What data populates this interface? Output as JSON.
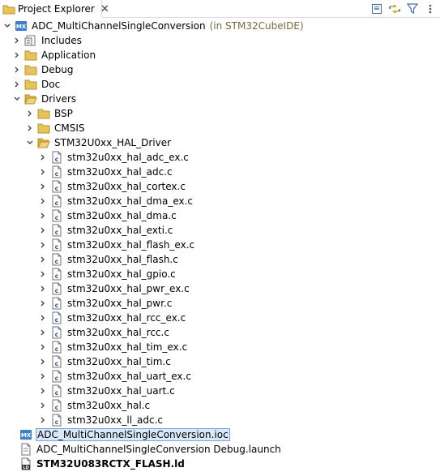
{
  "view": {
    "title": "Project Explorer",
    "close_glyph": "✕",
    "toolbar": [
      {
        "name": "collapse-all-icon"
      },
      {
        "name": "link-with-editor-icon"
      },
      {
        "name": "filter-icon"
      },
      {
        "name": "view-menu-icon"
      }
    ]
  },
  "tree": {
    "project": {
      "label": "ADC_MultiChannelSingleConversion",
      "suffix": "(in STM32CubeIDE)"
    },
    "top": [
      {
        "label": "Includes"
      },
      {
        "label": "Application"
      },
      {
        "label": "Debug"
      },
      {
        "label": "Doc"
      },
      {
        "label": "Drivers"
      }
    ],
    "drivers": [
      {
        "label": "BSP"
      },
      {
        "label": "CMSIS"
      },
      {
        "label": "STM32U0xx_HAL_Driver"
      }
    ],
    "hal_files": [
      {
        "label": "stm32u0xx_hal_adc_ex.c"
      },
      {
        "label": "stm32u0xx_hal_adc.c"
      },
      {
        "label": "stm32u0xx_hal_cortex.c"
      },
      {
        "label": "stm32u0xx_hal_dma_ex.c"
      },
      {
        "label": "stm32u0xx_hal_dma.c"
      },
      {
        "label": "stm32u0xx_hal_exti.c"
      },
      {
        "label": "stm32u0xx_hal_flash_ex.c"
      },
      {
        "label": "stm32u0xx_hal_flash.c"
      },
      {
        "label": "stm32u0xx_hal_gpio.c"
      },
      {
        "label": "stm32u0xx_hal_pwr_ex.c"
      },
      {
        "label": "stm32u0xx_hal_pwr.c"
      },
      {
        "label": "stm32u0xx_hal_rcc_ex.c"
      },
      {
        "label": "stm32u0xx_hal_rcc.c"
      },
      {
        "label": "stm32u0xx_hal_tim_ex.c"
      },
      {
        "label": "stm32u0xx_hal_tim.c"
      },
      {
        "label": "stm32u0xx_hal_uart_ex.c"
      },
      {
        "label": "stm32u0xx_hal_uart.c"
      },
      {
        "label": "stm32u0xx_hal.c"
      },
      {
        "label": "stm32u0xx_ll_adc.c"
      }
    ],
    "root_files": [
      {
        "label": "ADC_MultiChannelSingleConversion.ioc",
        "icon": "mx-ioc-icon",
        "selected": true
      },
      {
        "label": "ADC_MultiChannelSingleConversion Debug.launch",
        "icon": "launch-file-icon"
      },
      {
        "label": "STM32U083RCTX_FLASH.ld",
        "icon": "linker-script-icon",
        "bold": true
      }
    ]
  },
  "colors": {
    "folder": "#e8c35a",
    "folder_stroke": "#b8912a",
    "selection_bg": "#d9e8fb",
    "selection_border": "#7aa4d8",
    "suffix": "#7a6a3c"
  }
}
